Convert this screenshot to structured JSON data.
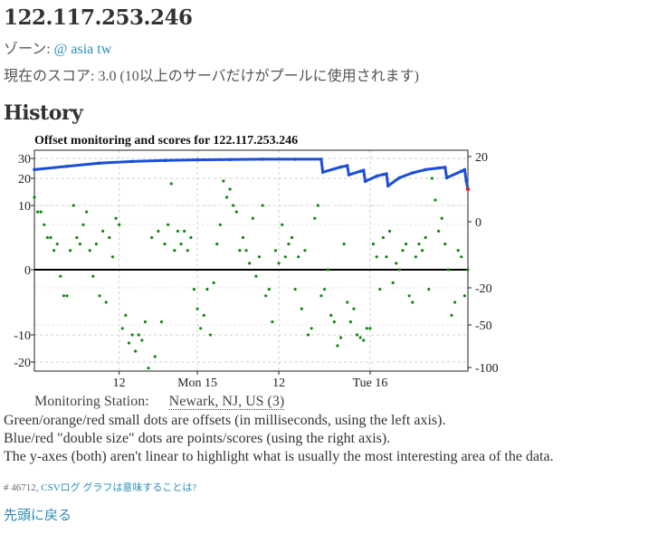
{
  "header": {
    "ip": "122.117.253.246",
    "zone_label": "ゾーン:",
    "zone_link": "@ asia tw",
    "score_text": "現在のスコア: 3.0 (10以上のサーバだけがプールに使用されます)"
  },
  "history": {
    "title": "History"
  },
  "chart_data": {
    "type": "scatter",
    "title": "Offset monitoring and scores for 122.117.253.246",
    "x_ticks": [
      "12",
      "Mon 15",
      "12",
      "Tue 16"
    ],
    "y_left_ticks": [
      "30",
      "20",
      "10",
      "0",
      "-10",
      "-20"
    ],
    "y_right_ticks": [
      "20",
      "0",
      "-20",
      "-50",
      "-100"
    ],
    "y_left_unit": "ms",
    "scales_nonlinear": true,
    "grid": true,
    "series": [
      {
        "name": "offsets",
        "color": "#118811",
        "axis": "left",
        "points": [
          [
            0,
            13
          ],
          [
            1,
            9
          ],
          [
            2,
            9
          ],
          [
            3,
            7
          ],
          [
            4,
            5
          ],
          [
            5,
            5
          ],
          [
            6,
            3
          ],
          [
            7,
            4
          ],
          [
            8,
            -1
          ],
          [
            9,
            -4
          ],
          [
            10,
            -4
          ],
          [
            11,
            3
          ],
          [
            12,
            10
          ],
          [
            13,
            5
          ],
          [
            14,
            4
          ],
          [
            15,
            7
          ],
          [
            16,
            9
          ],
          [
            17,
            3
          ],
          [
            18,
            -1
          ],
          [
            19,
            4
          ],
          [
            20,
            -4
          ],
          [
            21,
            6
          ],
          [
            22,
            -5
          ],
          [
            23,
            5
          ],
          [
            24,
            2
          ],
          [
            25,
            8
          ],
          [
            26,
            7
          ],
          [
            27,
            -9
          ],
          [
            28,
            -7
          ],
          [
            29,
            -13
          ],
          [
            30,
            -10
          ],
          [
            31,
            -16
          ],
          [
            32,
            -10
          ],
          [
            33,
            -12
          ],
          [
            34,
            -8
          ],
          [
            35,
            -22
          ],
          [
            36,
            5
          ],
          [
            37,
            -18
          ],
          [
            38,
            6
          ],
          [
            39,
            -8
          ],
          [
            40,
            4
          ],
          [
            41,
            7
          ],
          [
            42,
            18
          ],
          [
            43,
            3
          ],
          [
            44,
            6
          ],
          [
            45,
            4
          ],
          [
            46,
            6
          ],
          [
            47,
            3
          ],
          [
            48,
            5
          ],
          [
            49,
            -3
          ],
          [
            50,
            -6
          ],
          [
            51,
            -9
          ],
          [
            52,
            -7
          ],
          [
            53,
            -3
          ],
          [
            54,
            -10
          ],
          [
            55,
            -2
          ],
          [
            56,
            4
          ],
          [
            57,
            7
          ],
          [
            58,
            19
          ],
          [
            59,
            13
          ],
          [
            60,
            16
          ],
          [
            61,
            10
          ],
          [
            62,
            9
          ],
          [
            63,
            3
          ],
          [
            64,
            5
          ],
          [
            65,
            3
          ],
          [
            66,
            1
          ],
          [
            67,
            8
          ],
          [
            68,
            -1
          ],
          [
            69,
            2
          ],
          [
            70,
            10
          ],
          [
            71,
            -4
          ],
          [
            72,
            -3
          ],
          [
            73,
            -8
          ],
          [
            74,
            3
          ],
          [
            75,
            1
          ],
          [
            76,
            7
          ],
          [
            77,
            2
          ],
          [
            78,
            4
          ],
          [
            79,
            5
          ],
          [
            80,
            -3
          ],
          [
            81,
            2
          ],
          [
            82,
            -6
          ],
          [
            83,
            3
          ],
          [
            84,
            -10
          ],
          [
            85,
            -9
          ],
          [
            86,
            8
          ],
          [
            87,
            10
          ],
          [
            88,
            -4
          ],
          [
            89,
            -3
          ],
          [
            90,
            0
          ],
          [
            91,
            -7
          ],
          [
            92,
            -8
          ],
          [
            93,
            -14
          ],
          [
            94,
            -11
          ],
          [
            95,
            4
          ],
          [
            96,
            -5
          ],
          [
            97,
            -8
          ],
          [
            98,
            -6
          ],
          [
            99,
            -10
          ],
          [
            100,
            -11
          ],
          [
            101,
            -12
          ],
          [
            102,
            -9
          ],
          [
            103,
            -9
          ],
          [
            104,
            4
          ],
          [
            105,
            2
          ],
          [
            106,
            -3
          ],
          [
            107,
            5
          ],
          [
            108,
            2
          ],
          [
            109,
            6
          ],
          [
            110,
            -2
          ],
          [
            111,
            1
          ],
          [
            112,
            0
          ],
          [
            113,
            3
          ],
          [
            114,
            4
          ],
          [
            115,
            -4
          ],
          [
            116,
            -5
          ],
          [
            117,
            2
          ],
          [
            118,
            4
          ],
          [
            119,
            3
          ],
          [
            120,
            5
          ],
          [
            121,
            -3
          ],
          [
            122,
            20
          ],
          [
            123,
            12
          ],
          [
            124,
            6
          ],
          [
            125,
            8
          ],
          [
            126,
            4
          ],
          [
            127,
            0
          ],
          [
            128,
            -7
          ],
          [
            129,
            -5
          ],
          [
            130,
            3
          ],
          [
            131,
            2
          ],
          [
            132,
            -4
          ],
          [
            133,
            0
          ]
        ]
      },
      {
        "name": "scores",
        "color": "#1c4fd6",
        "axis": "right",
        "points": [
          [
            0,
            16
          ],
          [
            10,
            17
          ],
          [
            20,
            18
          ],
          [
            30,
            18.5
          ],
          [
            40,
            18.8
          ],
          [
            50,
            19
          ],
          [
            60,
            19.1
          ],
          [
            70,
            19.2
          ],
          [
            80,
            19.2
          ],
          [
            88,
            19.2
          ],
          [
            88.5,
            15.2
          ],
          [
            94,
            16.8
          ],
          [
            96,
            17.2
          ],
          [
            96.5,
            14.4
          ],
          [
            100,
            15.5
          ],
          [
            101,
            15.8
          ],
          [
            101.5,
            12.4
          ],
          [
            105,
            14
          ],
          [
            107,
            14.5
          ],
          [
            108,
            14.7
          ],
          [
            108.5,
            11
          ],
          [
            112,
            13.5
          ],
          [
            116,
            15
          ],
          [
            120,
            16
          ],
          [
            124,
            16.5
          ],
          [
            126,
            16.7
          ],
          [
            126.5,
            13.5
          ],
          [
            131,
            15.5
          ],
          [
            132,
            16
          ],
          [
            132.5,
            12.5
          ],
          [
            133,
            10
          ]
        ]
      }
    ]
  },
  "monitoring": {
    "label": "Monitoring Station:",
    "station": "Newark, NJ, US (3)"
  },
  "legend": {
    "line1": "Green/orange/red small dots are offsets (in milliseconds, using the left axis).",
    "line2": "Blue/red \"double size\" dots are points/scores (using the right axis).",
    "line3": "The y-axes (both) aren't linear to highlight what is usually the most interesting area of the data."
  },
  "footer": {
    "id_text": "# 46712,",
    "csv_link": "CSVログ",
    "meaning_link": "グラフは意味することは?"
  },
  "nav": {
    "back_to_top": "先頭に戻る"
  }
}
